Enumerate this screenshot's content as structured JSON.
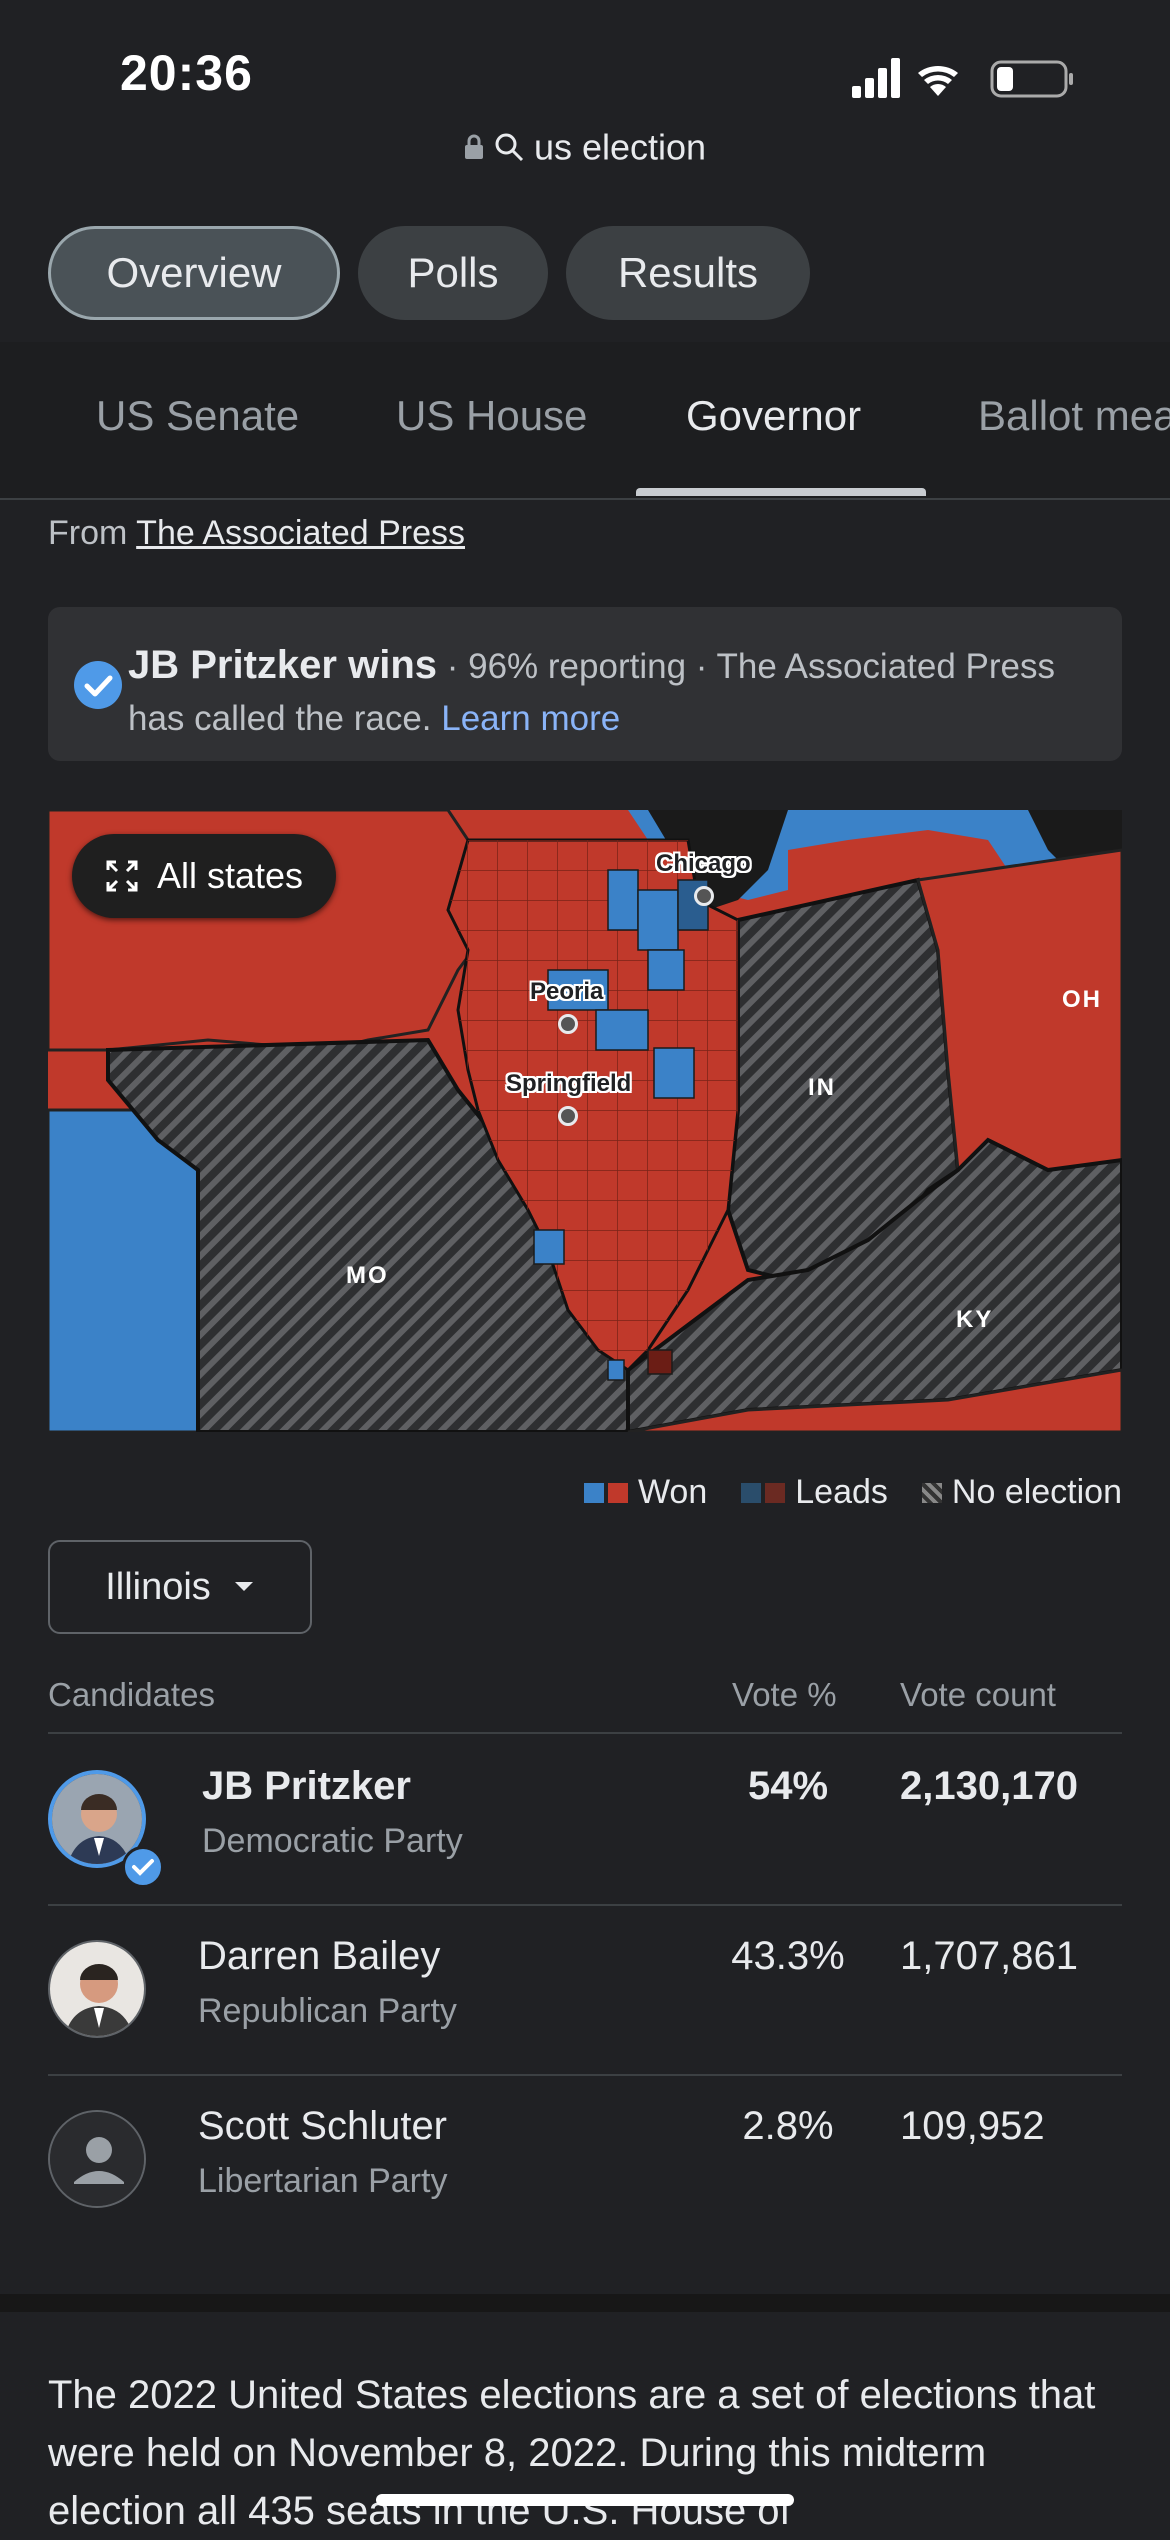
{
  "status_bar": {
    "time": "20:36"
  },
  "browser": {
    "url_text": "us election"
  },
  "chips": [
    {
      "label": "Overview",
      "selected": true
    },
    {
      "label": "Polls",
      "selected": false
    },
    {
      "label": "Results",
      "selected": false
    }
  ],
  "tabs": [
    {
      "label": "US Senate",
      "selected": false
    },
    {
      "label": "US House",
      "selected": false
    },
    {
      "label": "Governor",
      "selected": true
    },
    {
      "label": "Ballot measures",
      "selected": false
    }
  ],
  "source": {
    "prefix": "From",
    "name": "The Associated Press"
  },
  "banner": {
    "winner": "JB Pritzker wins",
    "details": " · 96% reporting · The Associated Press has called the race.",
    "link": "Learn more"
  },
  "map": {
    "expand_label": "All states",
    "state_labels": [
      "MO",
      "IN",
      "OH",
      "KY"
    ],
    "cities": [
      "Chicago",
      "Peoria",
      "Springfield"
    ],
    "colors": {
      "democrat": "#3b82c8",
      "republican": "#c0392b",
      "no_election": "#2e2f31"
    }
  },
  "legend": {
    "won": "Won",
    "leads": "Leads",
    "no_election": "No election"
  },
  "dropdown": {
    "selected": "Illinois"
  },
  "table": {
    "headers": {
      "candidates": "Candidates",
      "vote_pct": "Vote %",
      "vote_count": "Vote count"
    },
    "rows": [
      {
        "name": "JB Pritzker",
        "party": "Democratic Party",
        "pct": "54%",
        "count": "2,130,170",
        "winner": true
      },
      {
        "name": "Darren Bailey",
        "party": "Republican Party",
        "pct": "43.3%",
        "count": "1,707,861",
        "winner": false
      },
      {
        "name": "Scott Schluter",
        "party": "Libertarian Party",
        "pct": "2.8%",
        "count": "109,952",
        "winner": false
      }
    ]
  },
  "description": "The 2022 United States elections are a set of elections that were held on November 8, 2022. During this midterm election all 435 seats in the U.S. House of"
}
